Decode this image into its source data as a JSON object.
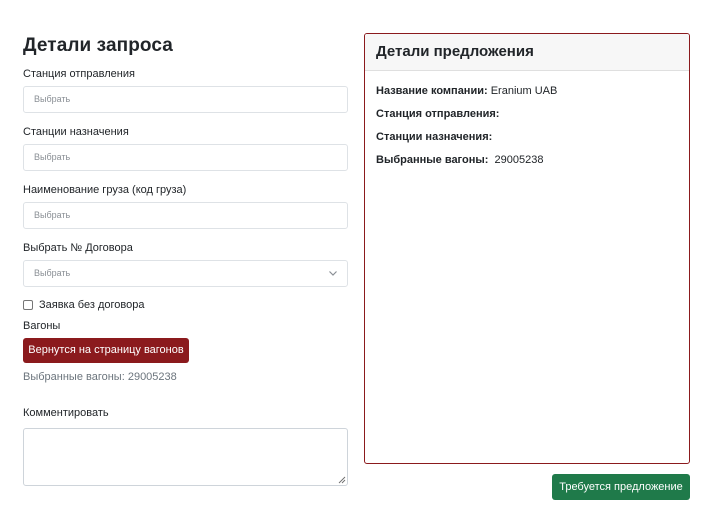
{
  "request": {
    "title": "Детали запроса",
    "departure_label": "Станция отправления",
    "departure_placeholder": "Выбрать",
    "destination_label": "Станции назначения",
    "destination_placeholder": "Выбрать",
    "cargo_label": "Наименование груза (код груза)",
    "cargo_placeholder": "Выбрать",
    "contract_label": "Выбрать № Договора",
    "contract_placeholder": "Выбрать",
    "no_contract_label": "Заявка без договора",
    "no_contract_checked": false,
    "wagons_label": "Вагоны",
    "back_button": "Вернутся на страницу вагонов",
    "selected_wagons_line": "Выбранные вагоны: 29005238",
    "comment_label": "Комментировать",
    "comment_value": ""
  },
  "offer": {
    "title": "Детали предложения",
    "company_key": "Название компании:",
    "company_value": " Eranium UAB",
    "departure_key": "Станция отправления:",
    "departure_value": "",
    "destination_key": "Станции назначения:",
    "destination_value": "",
    "wagons_key": "Выбранные вагоны:",
    "wagons_value": "  29005238"
  },
  "submit_button": "Требуется предложение",
  "colors": {
    "back_button": "#8b1a1d",
    "submit_button": "#1f7a4a",
    "card_border": "#8b1a1d"
  }
}
